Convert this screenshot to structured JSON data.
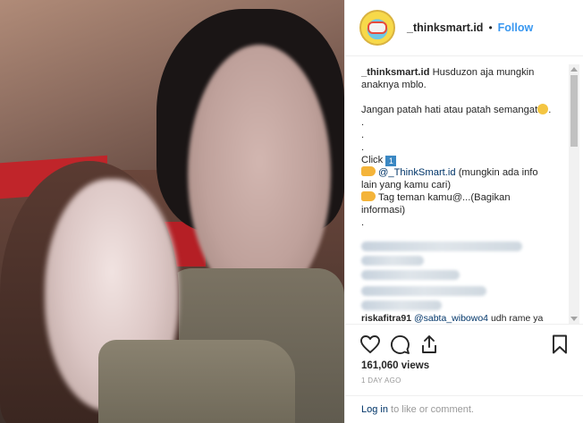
{
  "post": {
    "username": "_thinksmart.id",
    "separator": "•",
    "follow_label": "Follow"
  },
  "caption": {
    "user": "_thinksmart.id",
    "line1_rest": " Husduzon aja mungkin",
    "line2": "anaknya mblo.",
    "line3": "Jangan patah hati atau patah semangat",
    "dots": ".",
    "click_label": "Click ",
    "keycap": "1",
    "mention_link": "@_ThinkSmart.id",
    "mention_rest": " (mungkin ada info",
    "mention_rest2": "lain yang kamu cari)",
    "tag_line1": "Tag teman kamu@...(Bagikan",
    "tag_line2": "informasi)",
    "partial_comment_user": "riskafitra91",
    "partial_comment_mention": "@sabta_wibowo4",
    "partial_comment_text": "udh rame ya"
  },
  "stats": {
    "views": "161,060 views",
    "timestamp": "1 DAY AGO"
  },
  "footer": {
    "login_link": "Log in",
    "login_rest": " to like or comment."
  },
  "icons": {
    "like": "heart-icon",
    "comment": "comment-icon",
    "share": "share-icon",
    "save": "bookmark-icon"
  }
}
